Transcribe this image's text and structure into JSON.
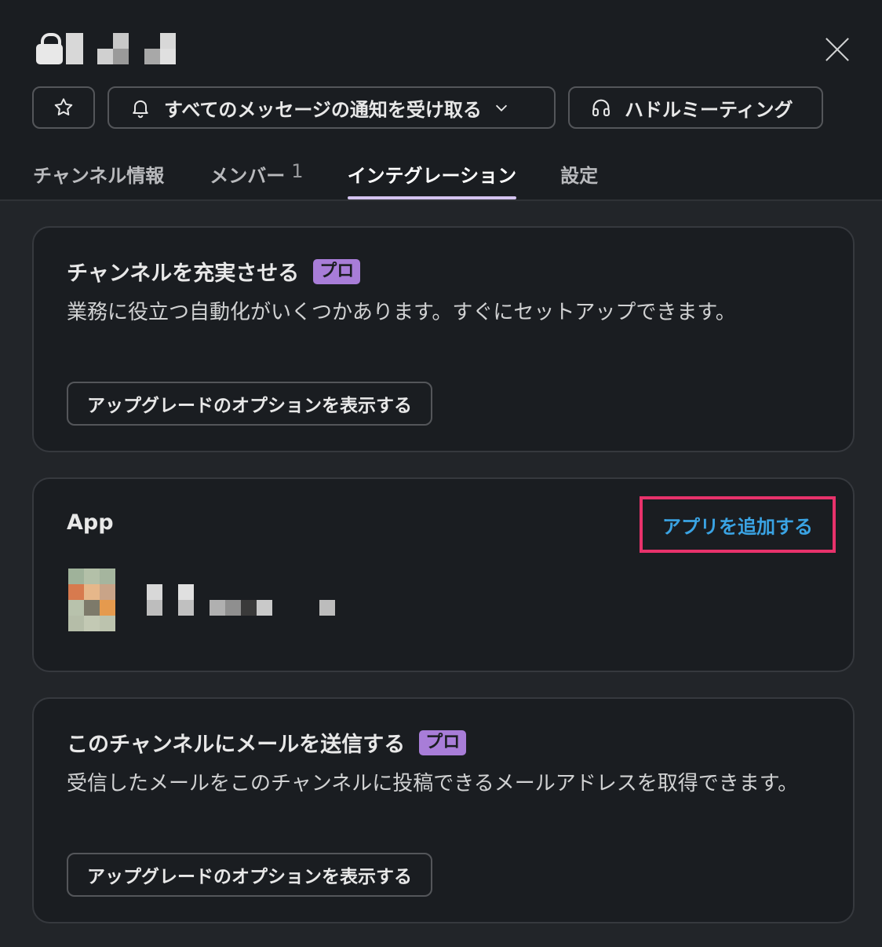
{
  "header": {
    "close_icon": "close-icon",
    "lock_icon": "lock-icon",
    "buttons": {
      "star_icon": "star-icon",
      "notify_label": "すべてのメッセージの通知を受け取る",
      "huddle_label": "ハドルミーティング"
    },
    "tabs": [
      {
        "label": "チャンネル情報"
      },
      {
        "label": "メンバー",
        "count": "1"
      },
      {
        "label": "インテグレーション"
      },
      {
        "label": "設定"
      }
    ]
  },
  "cards": {
    "enrich": {
      "title": "チャンネルを充実させる",
      "badge": "プロ",
      "description": "業務に役立つ自動化がいくつかあります。すぐにセットアップできます。",
      "button": "アップグレードのオプションを表示する"
    },
    "apps": {
      "label": "App",
      "add_link": "アプリを追加する"
    },
    "email": {
      "title": "このチャンネルにメールを送信する",
      "badge": "プロ",
      "description": "受信したメールをこのチャンネルに投稿できるメールアドレスを取得できます。",
      "button": "アップグレードのオプションを表示する"
    }
  },
  "colors": {
    "background": "#1a1d21",
    "panel": "#222529",
    "accent_tab": "#d4c3f0",
    "badge": "#a87dd8",
    "link": "#3aa3e3",
    "highlight": "#e8326b"
  }
}
